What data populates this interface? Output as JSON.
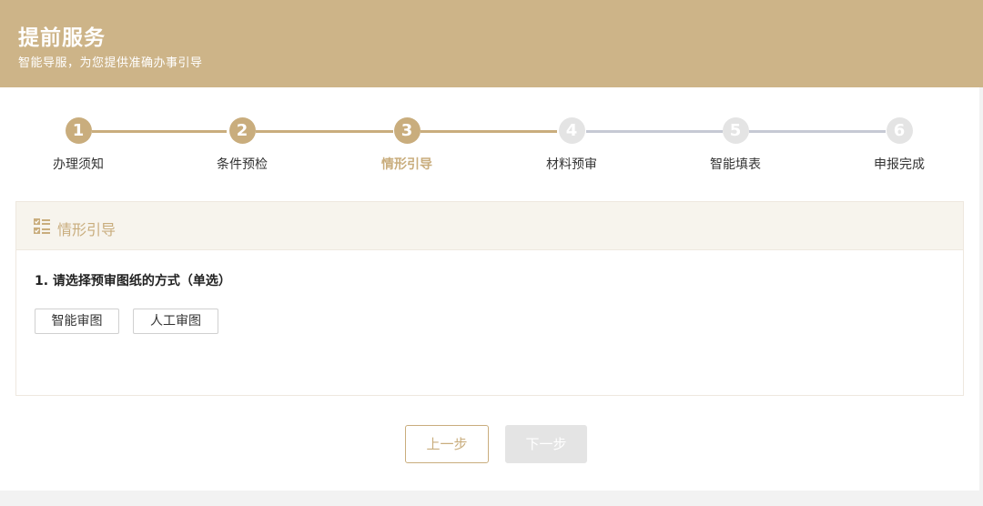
{
  "header": {
    "title": "提前服务",
    "subtitle": "智能导服，为您提供准确办事引导"
  },
  "steps": [
    {
      "num": "1",
      "label": "办理须知",
      "state": "done"
    },
    {
      "num": "2",
      "label": "条件预检",
      "state": "done"
    },
    {
      "num": "3",
      "label": "情形引导",
      "state": "active"
    },
    {
      "num": "4",
      "label": "材料预审",
      "state": "todo"
    },
    {
      "num": "5",
      "label": "智能填表",
      "state": "todo"
    },
    {
      "num": "6",
      "label": "申报完成",
      "state": "todo"
    }
  ],
  "section": {
    "title": "情形引导",
    "icon": "checklist-icon",
    "question": "1. 请选择预审图纸的方式（单选）",
    "options": [
      "智能审图",
      "人工审图"
    ]
  },
  "buttons": {
    "prev": "上一步",
    "next": "下一步"
  },
  "colors": {
    "accent": "#c9ad7d",
    "header_bg": "#cdb488",
    "inactive": "#e4e4e4",
    "inactive_line": "#c6c9d4"
  }
}
